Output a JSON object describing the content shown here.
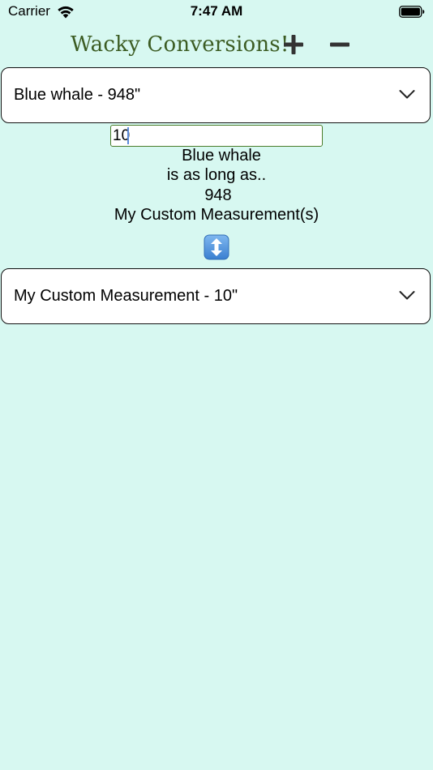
{
  "status_bar": {
    "carrier": "Carrier",
    "time": "7:47 AM"
  },
  "header": {
    "title": "Wacky Conversions!",
    "add_icon": "plus-icon",
    "remove_icon": "minus-icon"
  },
  "from_select": {
    "selected": "Blue whale - 948\""
  },
  "quantity_input": {
    "value": "10"
  },
  "result": {
    "subject": "Blue whale",
    "relation": "is as long as..",
    "amount": "948",
    "unit": "My Custom Measurement(s)"
  },
  "swap_button": {
    "icon": "up-down-arrow-icon"
  },
  "to_select": {
    "selected": "My Custom Measurement - 10\""
  },
  "colors": {
    "background": "#d7f8f1",
    "title": "#3c5c23",
    "input_border": "#4b7d2b",
    "swap_button": "#4d8fd8"
  }
}
